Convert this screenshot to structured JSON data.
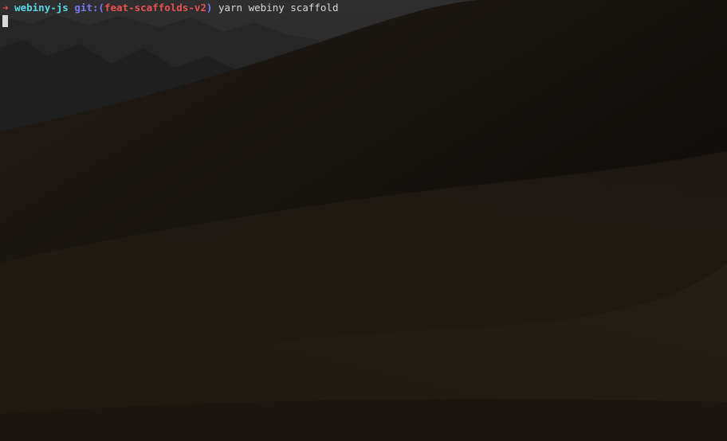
{
  "terminal": {
    "prompt": {
      "arrow": "➜",
      "directory": "webiny-js",
      "git_prefix": "git:(",
      "branch": "feat-scaffolds-v2",
      "git_suffix": ")",
      "command": "yarn webiny scaffold"
    }
  },
  "colors": {
    "arrow": "#e8524f",
    "directory": "#58d7e6",
    "git": "#7b7bf5",
    "branch": "#e8524f",
    "text": "#d9d9d9",
    "background": "#1a1612"
  }
}
